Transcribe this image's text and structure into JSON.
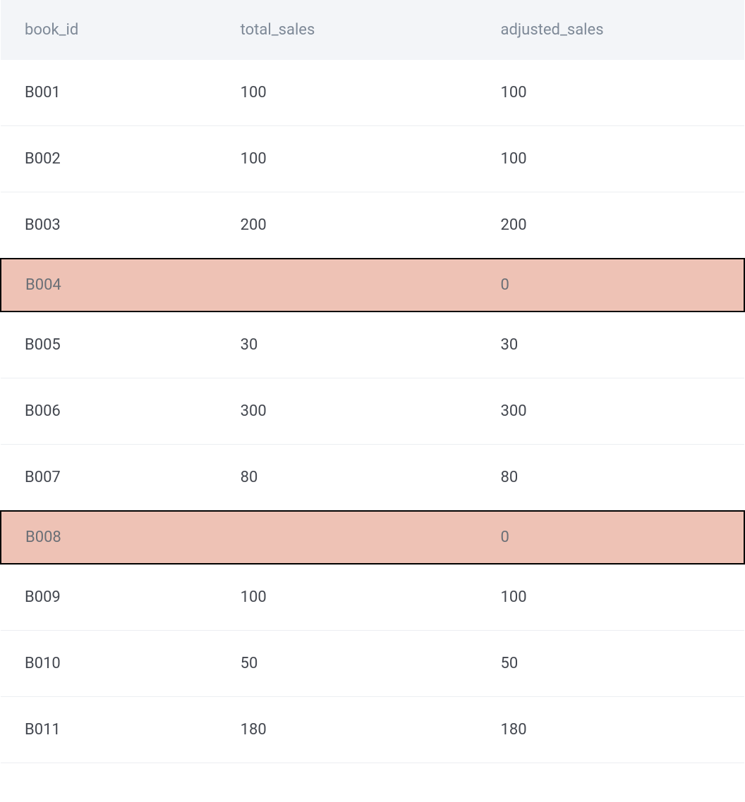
{
  "table": {
    "columns": [
      "book_id",
      "total_sales",
      "adjusted_sales"
    ],
    "rows": [
      {
        "book_id": "B001",
        "total_sales": "100",
        "adjusted_sales": "100",
        "highlight": false
      },
      {
        "book_id": "B002",
        "total_sales": "100",
        "adjusted_sales": "100",
        "highlight": false
      },
      {
        "book_id": "B003",
        "total_sales": "200",
        "adjusted_sales": "200",
        "highlight": false
      },
      {
        "book_id": "B004",
        "total_sales": "",
        "adjusted_sales": "0",
        "highlight": true
      },
      {
        "book_id": "B005",
        "total_sales": "30",
        "adjusted_sales": "30",
        "highlight": false
      },
      {
        "book_id": "B006",
        "total_sales": "300",
        "adjusted_sales": "300",
        "highlight": false
      },
      {
        "book_id": "B007",
        "total_sales": "80",
        "adjusted_sales": "80",
        "highlight": false
      },
      {
        "book_id": "B008",
        "total_sales": "",
        "adjusted_sales": "0",
        "highlight": true
      },
      {
        "book_id": "B009",
        "total_sales": "100",
        "adjusted_sales": "100",
        "highlight": false
      },
      {
        "book_id": "B010",
        "total_sales": "50",
        "adjusted_sales": "50",
        "highlight": false
      },
      {
        "book_id": "B011",
        "total_sales": "180",
        "adjusted_sales": "180",
        "highlight": false
      }
    ]
  },
  "chart_data": {
    "type": "table",
    "columns": [
      "book_id",
      "total_sales",
      "adjusted_sales"
    ],
    "rows": [
      [
        "B001",
        100,
        100
      ],
      [
        "B002",
        100,
        100
      ],
      [
        "B003",
        200,
        200
      ],
      [
        "B004",
        null,
        0
      ],
      [
        "B005",
        30,
        30
      ],
      [
        "B006",
        300,
        300
      ],
      [
        "B007",
        80,
        80
      ],
      [
        "B008",
        null,
        0
      ],
      [
        "B009",
        100,
        100
      ],
      [
        "B010",
        50,
        50
      ],
      [
        "B011",
        180,
        180
      ]
    ]
  }
}
